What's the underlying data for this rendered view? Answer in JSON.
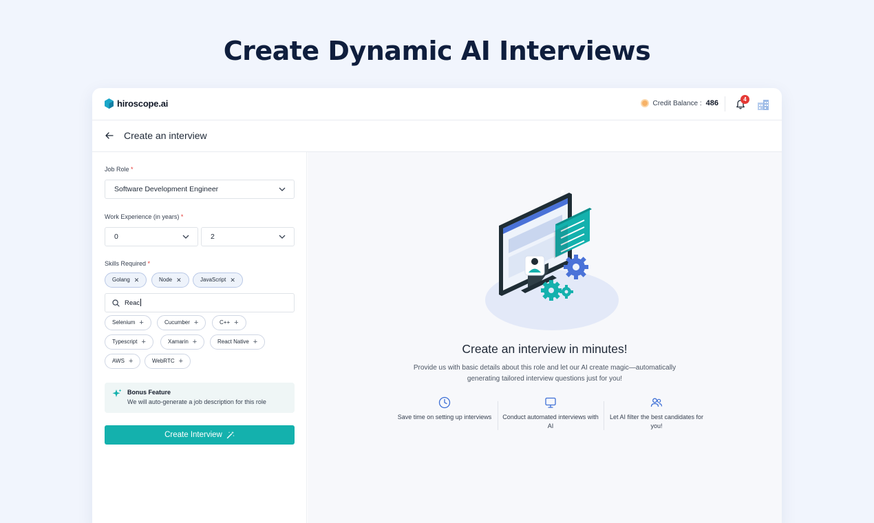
{
  "headline": "Create Dynamic AI Interviews",
  "app": {
    "logo_text": "hiroscope.ai",
    "credit_label": "Credit Balance :",
    "credit_value": "486",
    "notification_count": "4"
  },
  "subheader": {
    "title": "Create an interview"
  },
  "form": {
    "job_role_label": "Job Role",
    "job_role_value": "Software Development Engineer",
    "experience_label": "Work Experience (in years)",
    "experience_min": "0",
    "experience_max": "2",
    "skills_label": "Skills Required",
    "required_marker": "*",
    "selected_skills": [
      "Golang",
      "Node",
      "JavaScript"
    ],
    "search_value": "Reac",
    "suggested_skills": [
      "Selenium",
      "Cucumber",
      "C++",
      "Typescript",
      "Xamarin",
      "React Native",
      "AWS",
      "WebRTC"
    ],
    "bonus_title": "Bonus Feature",
    "bonus_text": "We will auto-generate a job description for this role",
    "submit_label": "Create Interview"
  },
  "hero": {
    "title": "Create an interview in minutes!",
    "description": "Provide us with basic details about this role and let our AI create magic—automatically generating tailored interview questions just for you!",
    "features": [
      {
        "icon": "clock-icon",
        "text": "Save time on setting up interviews"
      },
      {
        "icon": "monitor-icon",
        "text": "Conduct automated interviews with AI"
      },
      {
        "icon": "users-icon",
        "text": "Let AI filter the best candidates for you!"
      }
    ]
  },
  "colors": {
    "accent": "#14b1ad",
    "headline": "#0f1e3d",
    "badge": "#e53935",
    "chip_border": "#b9c8e6"
  }
}
